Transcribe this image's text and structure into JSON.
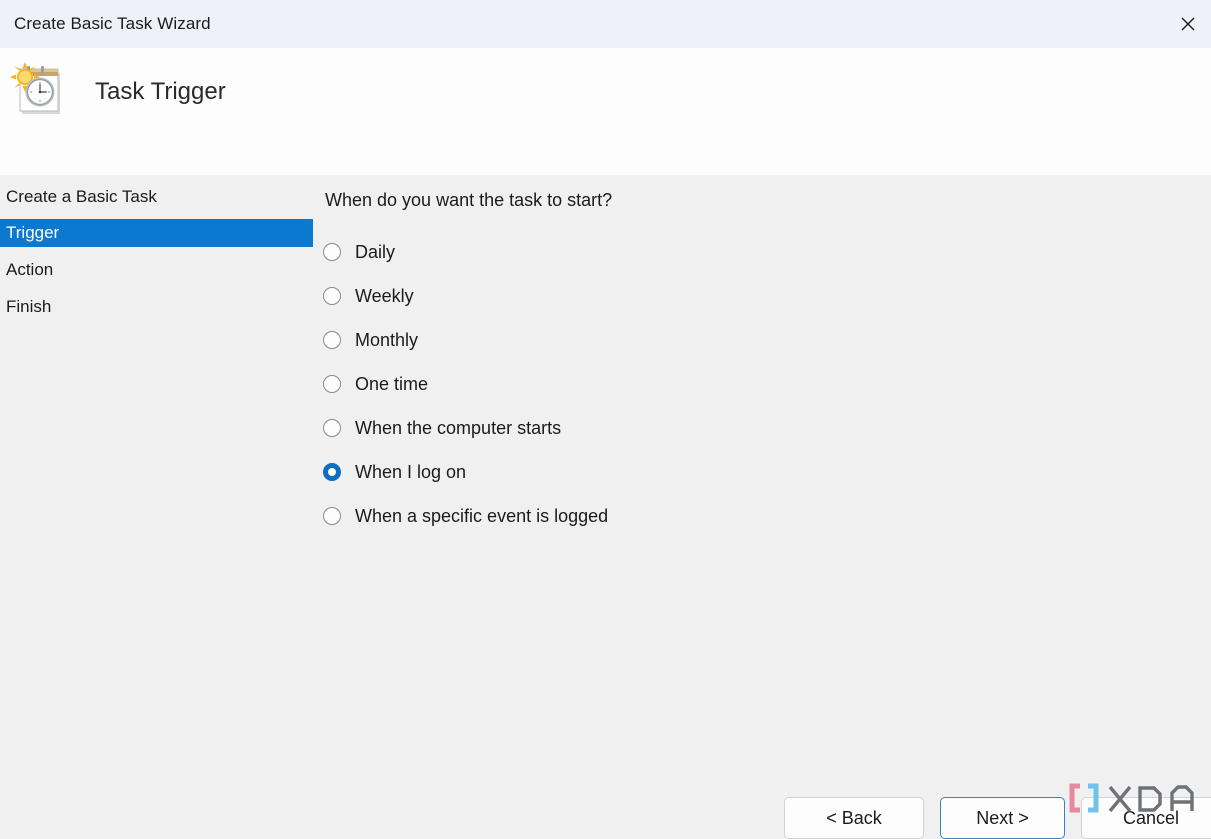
{
  "window": {
    "title": "Create Basic Task Wizard",
    "close_icon": "close-icon"
  },
  "header": {
    "icon": "task-trigger-calendar-clock-icon",
    "title": "Task Trigger"
  },
  "sidebar": {
    "items": [
      {
        "label": "Create a Basic Task",
        "selected": false
      },
      {
        "label": "Trigger",
        "selected": true
      },
      {
        "label": "Action",
        "selected": false
      },
      {
        "label": "Finish",
        "selected": false
      }
    ]
  },
  "main": {
    "question": "When do you want the task to start?",
    "options": [
      {
        "label": "Daily",
        "checked": false
      },
      {
        "label": "Weekly",
        "checked": false
      },
      {
        "label": "Monthly",
        "checked": false
      },
      {
        "label": "One time",
        "checked": false
      },
      {
        "label": "When the computer starts",
        "checked": false
      },
      {
        "label": "When I log on",
        "checked": true
      },
      {
        "label": "When a specific event is logged",
        "checked": false
      }
    ],
    "selected_option": "When I log on"
  },
  "footer": {
    "back_label": "< Back",
    "next_label": "Next >",
    "cancel_label": "Cancel"
  },
  "watermark": {
    "text": "XDA"
  },
  "colors": {
    "titlebar_bg": "#eef1f9",
    "header_bg": "#fdfdfd",
    "body_bg": "#f0f0f0",
    "accent_blue": "#0b78d1",
    "radio_blue": "#0b6fc4",
    "focus_border": "#3b7fc4",
    "text": "#1b1b1b"
  }
}
